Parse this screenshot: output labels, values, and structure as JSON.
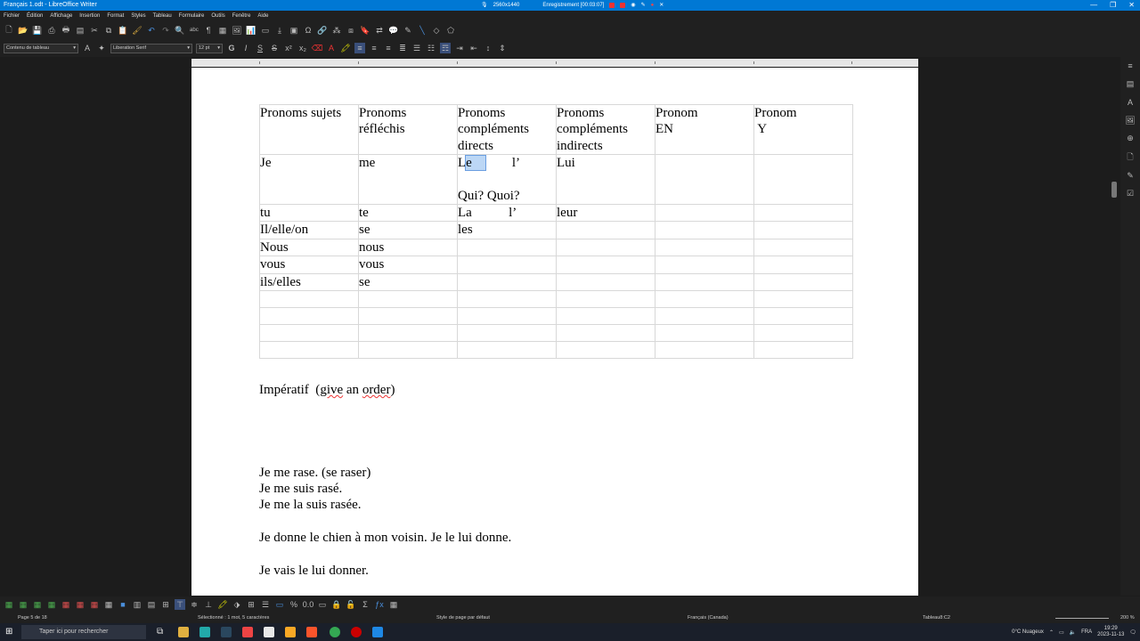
{
  "window": {
    "title": "Français 1.odt - LibreOffice Writer",
    "recording": {
      "resolution": "2560x1440",
      "status": "Enregistrement [00:03:07]"
    }
  },
  "menu": [
    "Fichier",
    "Édition",
    "Affichage",
    "Insertion",
    "Format",
    "Styles",
    "Tableau",
    "Formulaire",
    "Outils",
    "Fenêtre",
    "Aide"
  ],
  "format_bar": {
    "paragraph_style": "Contenu de tableau",
    "font_name": "Liberation Serif",
    "font_size": "12 pt",
    "bold": "G",
    "italic": "I",
    "underline": "S",
    "strike": "S"
  },
  "table": {
    "rows": [
      [
        [
          "Pronoms sujets"
        ],
        [
          "Pronoms",
          "réfléchis"
        ],
        [
          "Pronoms",
          "compléments",
          "directs"
        ],
        [
          "Pronoms",
          "compléments",
          "indirects"
        ],
        [
          "Pronom",
          "EN"
        ],
        [
          "Pronom",
          " Y"
        ]
      ],
      [
        [
          "Je"
        ],
        [
          "me"
        ],
        [
          "Le           l’",
          "",
          "Qui? Quoi?"
        ],
        [
          "Lui"
        ],
        [
          ""
        ],
        [
          ""
        ]
      ],
      [
        [
          "tu"
        ],
        [
          "te"
        ],
        [
          "La           l’"
        ],
        [
          "leur"
        ],
        [
          ""
        ],
        [
          ""
        ]
      ],
      [
        [
          "Il/elle/on"
        ],
        [
          "se"
        ],
        [
          "les"
        ],
        [
          ""
        ],
        [
          ""
        ],
        [
          ""
        ]
      ],
      [
        [
          "Nous"
        ],
        [
          "nous"
        ],
        [
          ""
        ],
        [
          ""
        ],
        [
          ""
        ],
        [
          ""
        ]
      ],
      [
        [
          "vous"
        ],
        [
          "vous"
        ],
        [
          ""
        ],
        [
          ""
        ],
        [
          ""
        ],
        [
          ""
        ]
      ],
      [
        [
          "ils/elles"
        ],
        [
          "se"
        ],
        [
          ""
        ],
        [
          ""
        ],
        [
          ""
        ],
        [
          ""
        ]
      ],
      [
        [
          ""
        ],
        [
          ""
        ],
        [
          ""
        ],
        [
          ""
        ],
        [
          ""
        ],
        [
          ""
        ]
      ],
      [
        [
          ""
        ],
        [
          ""
        ],
        [
          ""
        ],
        [
          ""
        ],
        [
          ""
        ],
        [
          ""
        ]
      ],
      [
        [
          ""
        ],
        [
          ""
        ],
        [
          ""
        ],
        [
          ""
        ],
        [
          ""
        ],
        [
          ""
        ]
      ],
      [
        [
          ""
        ],
        [
          ""
        ],
        [
          ""
        ],
        [
          ""
        ],
        [
          ""
        ],
        [
          ""
        ]
      ]
    ]
  },
  "body": {
    "imperatif_a": "Impératif  (",
    "imperatif_b": "give",
    "imperatif_c": " an ",
    "imperatif_d": "order",
    "imperatif_e": ")",
    "line1": "Je me rase. (se raser)",
    "line2": "Je me suis rasé.",
    "line3": "Je me la suis rasée.",
    "line4": "Je donne le chien à mon voisin. Je le lui donne.",
    "line5": "Je vais le lui donner."
  },
  "status": {
    "page": "Page 5 de 18",
    "selection": "Sélectionné : 1 mot, 5 caractères",
    "page_style": "Style de page par défaut",
    "language": "Français (Canada)",
    "table_cell": "Tableau8:C2",
    "zoom": "200 %"
  },
  "taskbar": {
    "search_placeholder": "Taper ici pour rechercher",
    "weather": "0°C  Nuageux",
    "lang": "FRA",
    "time": "19:29",
    "date": "2023-11-13"
  }
}
